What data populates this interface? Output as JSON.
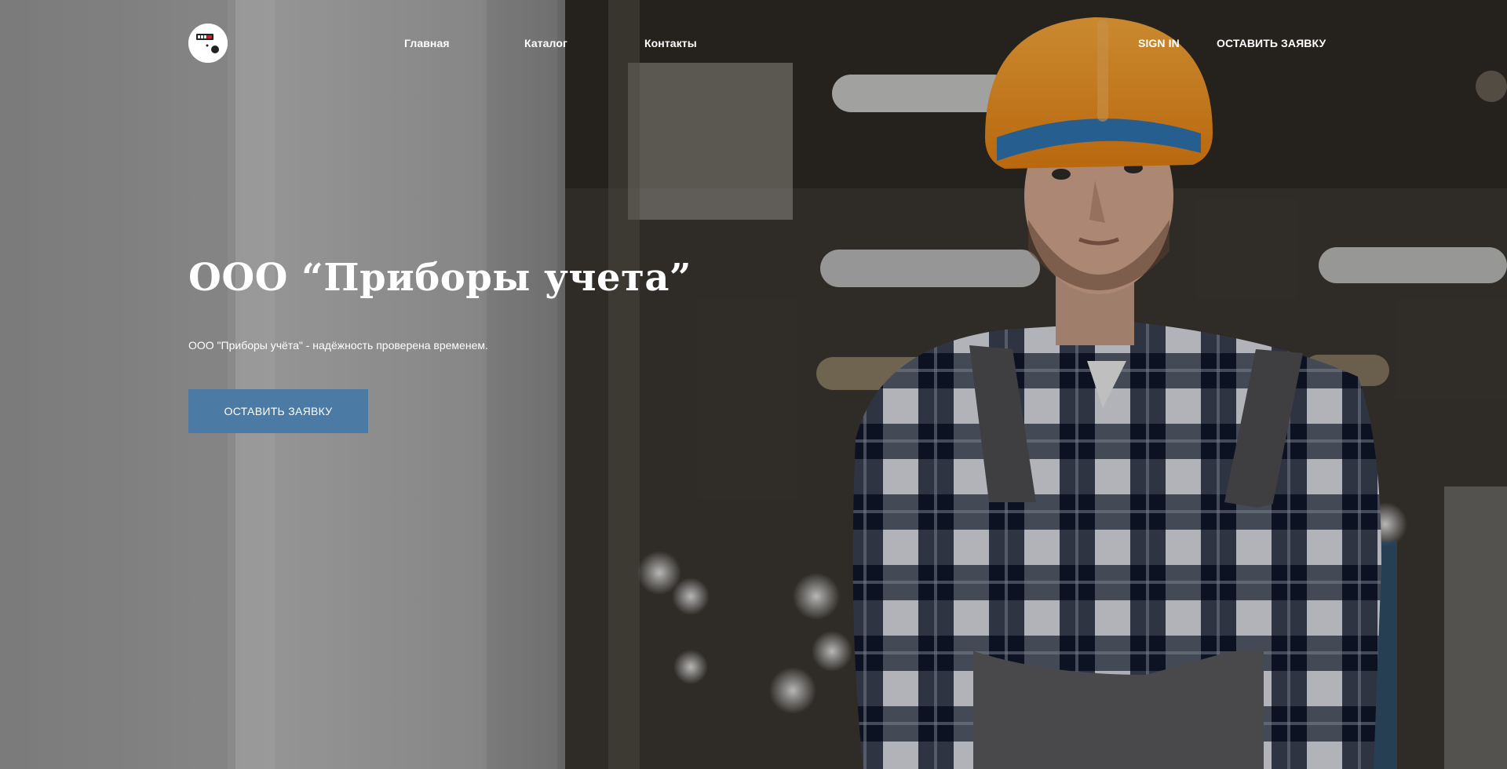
{
  "header": {
    "logo_icon": "meter-logo-icon",
    "nav": {
      "home": "Главная",
      "catalog": "Каталог",
      "contacts": "Контакты"
    },
    "sign_in": "SIGN IN",
    "order_label": "ОСТАВИТЬ ЗАЯВКУ"
  },
  "hero": {
    "title": "ООО “Приборы учета”",
    "subtitle": "ООО \"Приборы учёта\" - надёжность проверена временем.",
    "cta_label": "ОСТАВИТЬ ЗАЯВКУ",
    "image": "worker-in-hard-hat-photo"
  },
  "colors": {
    "accent": "#4b7ba4",
    "text": "#ffffff",
    "helmet": "#f0941f"
  }
}
